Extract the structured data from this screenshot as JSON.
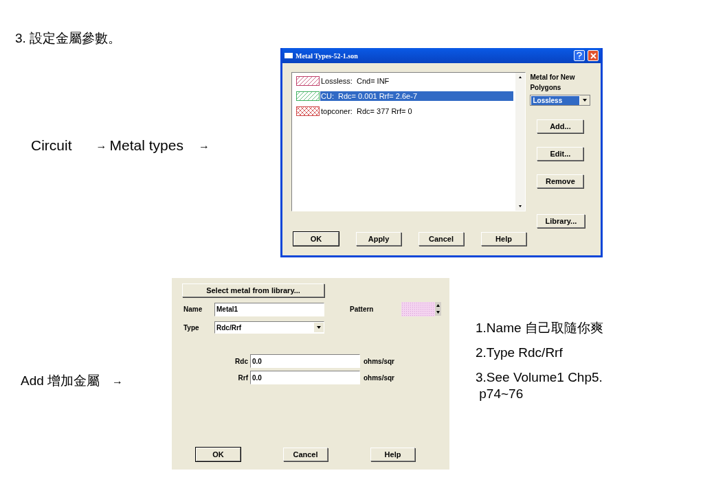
{
  "heading": "3. 設定金屬參數。",
  "flow": [
    "Circuit",
    "→",
    "Metal types",
    "→"
  ],
  "add_flow": [
    "Add 增加金屬",
    "→"
  ],
  "metal_types_dialog": {
    "title": "Metal Types-52-1.son",
    "items": [
      {
        "label": "Lossless:  Cnd= INF",
        "kind": "hatch",
        "color": "#c0406a",
        "selected": false
      },
      {
        "label": "CU:  Rdc= 0.001 Rrf= 2.6e-7",
        "kind": "hatch",
        "color": "#40b060",
        "selected": true
      },
      {
        "label": "topconer:  Rdc= 377 Rrf= 0",
        "kind": "crosshatch",
        "color": "#d04848",
        "selected": false
      }
    ],
    "new_polygon_label": "Metal for New Polygons",
    "new_polygon_value": "Lossless",
    "side_buttons": [
      "Add...",
      "Edit...",
      "Remove"
    ],
    "library_button": "Library...",
    "buttons": [
      {
        "label": "OK",
        "default": true
      },
      {
        "label": "Apply",
        "default": false
      },
      {
        "label": "Cancel",
        "default": false
      },
      {
        "label": "Help",
        "default": false
      }
    ]
  },
  "add_dialog": {
    "library_button": "Select metal from library...",
    "name_label": "Name",
    "name_value": "Metal1",
    "pattern_label": "Pattern",
    "type_label": "Type",
    "type_value": "Rdc/Rrf",
    "fields": [
      {
        "label": "Rdc",
        "value": "0.0",
        "unit": "ohms/sqr"
      },
      {
        "label": "Rrf",
        "value": "0.0",
        "unit": "ohms/sqr"
      }
    ],
    "buttons": [
      {
        "label": "OK",
        "default": true
      },
      {
        "label": "Cancel",
        "default": false
      },
      {
        "label": "Help",
        "default": false
      }
    ]
  },
  "notes": [
    "1.Name 自己取隨你爽",
    "2.Type Rdc/Rrf",
    "3.See Volume1 Chp5.\n p74~76"
  ]
}
